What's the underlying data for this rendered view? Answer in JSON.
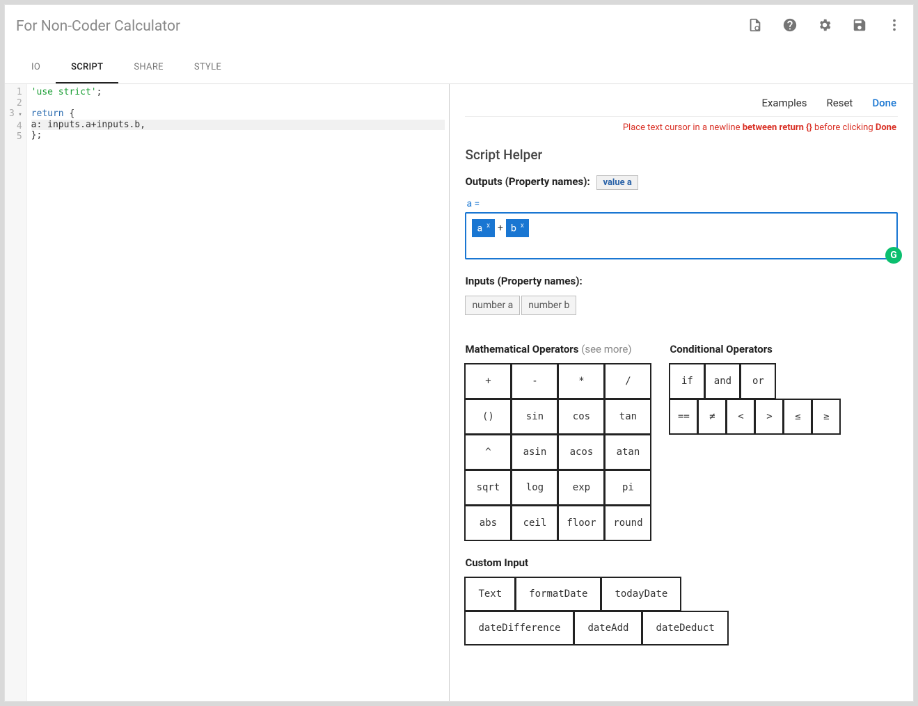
{
  "title": "For Non-Coder Calculator",
  "tabs": [
    "IO",
    "SCRIPT",
    "SHARE",
    "STYLE"
  ],
  "active_tab": 1,
  "code": {
    "lines": [
      {
        "n": "1",
        "seg": [
          {
            "t": "'use strict'",
            "c": "kw-str"
          },
          {
            "t": ";",
            "c": "ident"
          }
        ]
      },
      {
        "n": "2",
        "seg": []
      },
      {
        "n": "3",
        "fold": true,
        "seg": [
          {
            "t": "return",
            "c": "kw"
          },
          {
            "t": " {",
            "c": "ident"
          }
        ]
      },
      {
        "n": "4",
        "hl": true,
        "seg": [
          {
            "t": "a: inputs.a+inputs.b,",
            "c": "ident"
          }
        ]
      },
      {
        "n": "5",
        "seg": [
          {
            "t": "};",
            "c": "ident"
          }
        ]
      }
    ]
  },
  "helper": {
    "top_links": {
      "examples": "Examples",
      "reset": "Reset",
      "done": "Done"
    },
    "hint_pre": "Place text cursor in a newline ",
    "hint_bold1": "between return {}",
    "hint_mid": " before clicking ",
    "hint_bold2": "Done",
    "title": "Script Helper",
    "outputs_label": "Outputs (Property names):",
    "outputs": [
      "value a"
    ],
    "formula_label": "a =",
    "formula_tokens": [
      {
        "type": "var",
        "text": "a"
      },
      {
        "type": "op",
        "text": "+"
      },
      {
        "type": "var",
        "text": "b"
      }
    ],
    "inputs_label": "Inputs (Property names):",
    "inputs": [
      "number a",
      "number b"
    ],
    "math_label": "Mathematical Operators",
    "math_more": "(see more)",
    "math_ops": [
      [
        "+",
        "-",
        "*",
        "/"
      ],
      [
        "()",
        "sin",
        "cos",
        "tan"
      ],
      [
        "^",
        "asin",
        "acos",
        "atan"
      ],
      [
        "sqrt",
        "log",
        "exp",
        "pi"
      ],
      [
        "abs",
        "ceil",
        "floor",
        "round"
      ]
    ],
    "cond_label": "Conditional Operators",
    "cond_ops_row1": [
      "if",
      "and",
      "or"
    ],
    "cond_ops_row2": [
      "==",
      "≠",
      "<",
      ">",
      "≤",
      "≥"
    ],
    "custom_label": "Custom Input",
    "custom_ops": [
      [
        "Text",
        "formatDate",
        "todayDate"
      ],
      [
        "dateDifference",
        "dateAdd",
        "dateDeduct"
      ]
    ]
  }
}
